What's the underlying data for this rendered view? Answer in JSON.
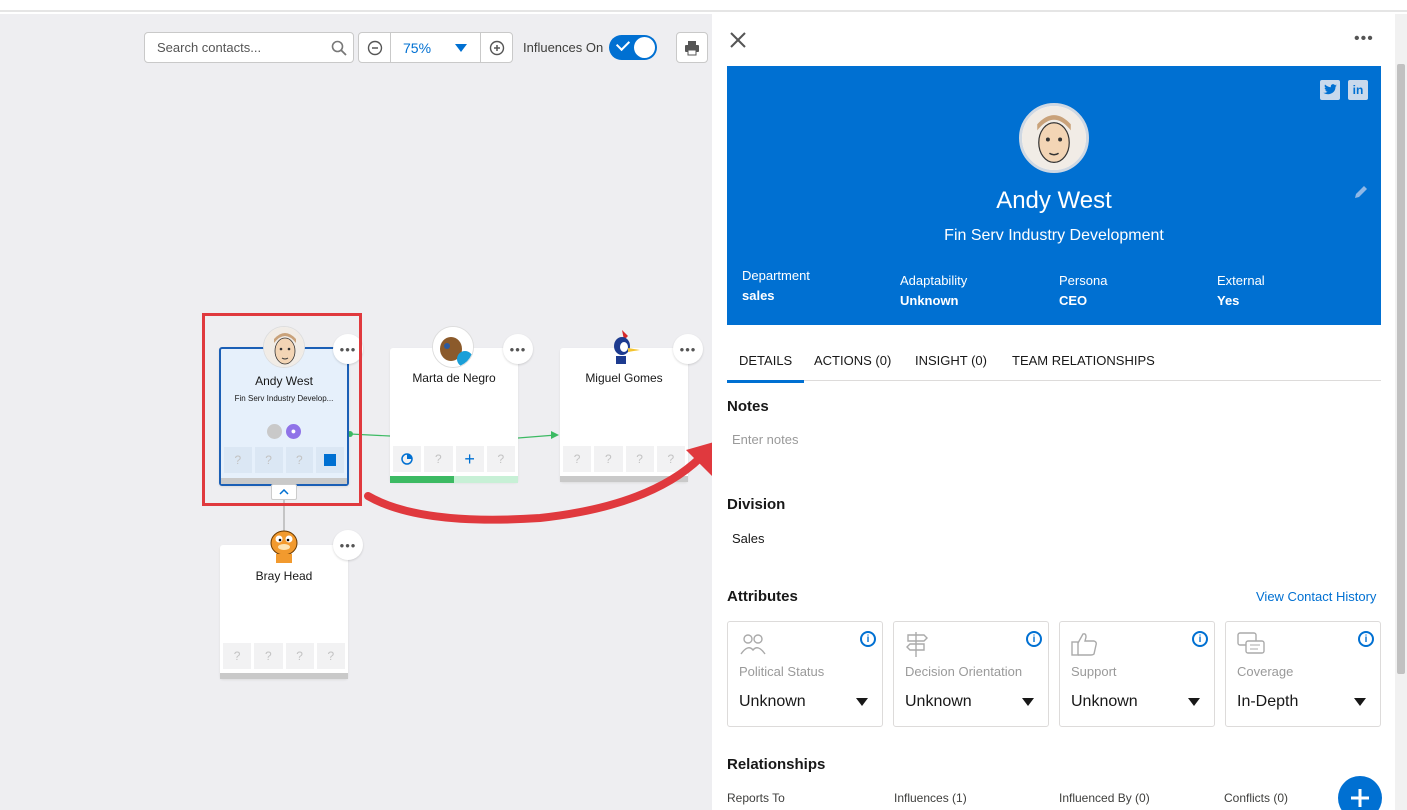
{
  "toolbar": {
    "search_placeholder": "Search contacts...",
    "zoom_value": "75%",
    "influences_label": "Influences On",
    "influences_on": true
  },
  "cards": [
    {
      "name": "Andy West",
      "title": "Fin Serv Industry Develop...",
      "cells": [
        "?",
        "?",
        "?"
      ],
      "selected": true
    },
    {
      "name": "Marta de Negro",
      "cells": [
        "?",
        "?"
      ],
      "progress": 0.5
    },
    {
      "name": "Miguel Gomes",
      "cells": [
        "?",
        "?",
        "?",
        "?"
      ]
    },
    {
      "name": "Bray Head",
      "cells": [
        "?",
        "?",
        "?",
        "?"
      ]
    }
  ],
  "more_glyph": "•••",
  "panel": {
    "contact_name": "Andy West",
    "contact_title": "Fin Serv Industry Development",
    "social": [
      "twitter-icon",
      "linkedin-icon"
    ],
    "fields": [
      {
        "label": "Department",
        "value": "sales"
      },
      {
        "label": "Adaptability",
        "value": "Unknown"
      },
      {
        "label": "Persona",
        "value": "CEO"
      },
      {
        "label": "External",
        "value": "Yes"
      }
    ],
    "tabs": [
      "DETAILS",
      "ACTIONS (0)",
      "INSIGHT (0)",
      "TEAM RELATIONSHIPS"
    ],
    "notes_heading": "Notes",
    "notes_placeholder": "Enter notes",
    "division_heading": "Division",
    "division_value": "Sales",
    "attributes_heading": "Attributes",
    "view_history_link": "View Contact History",
    "attributes": [
      {
        "label": "Political Status",
        "value": "Unknown",
        "icon": "political-status-icon"
      },
      {
        "label": "Decision Orientation",
        "value": "Unknown",
        "icon": "decision-orientation-icon"
      },
      {
        "label": "Support",
        "value": "Unknown",
        "icon": "thumbs-up-icon"
      },
      {
        "label": "Coverage",
        "value": "In-Depth",
        "icon": "coverage-icon"
      }
    ],
    "relationships_heading": "Relationships",
    "relationships": [
      "Reports To",
      "Influences (1)",
      "Influenced By (0)",
      "Conflicts (0)"
    ]
  },
  "colors": {
    "accent": "#0070d2",
    "highlight_box": "#e0393e",
    "progress_fill": "#3cba63"
  }
}
